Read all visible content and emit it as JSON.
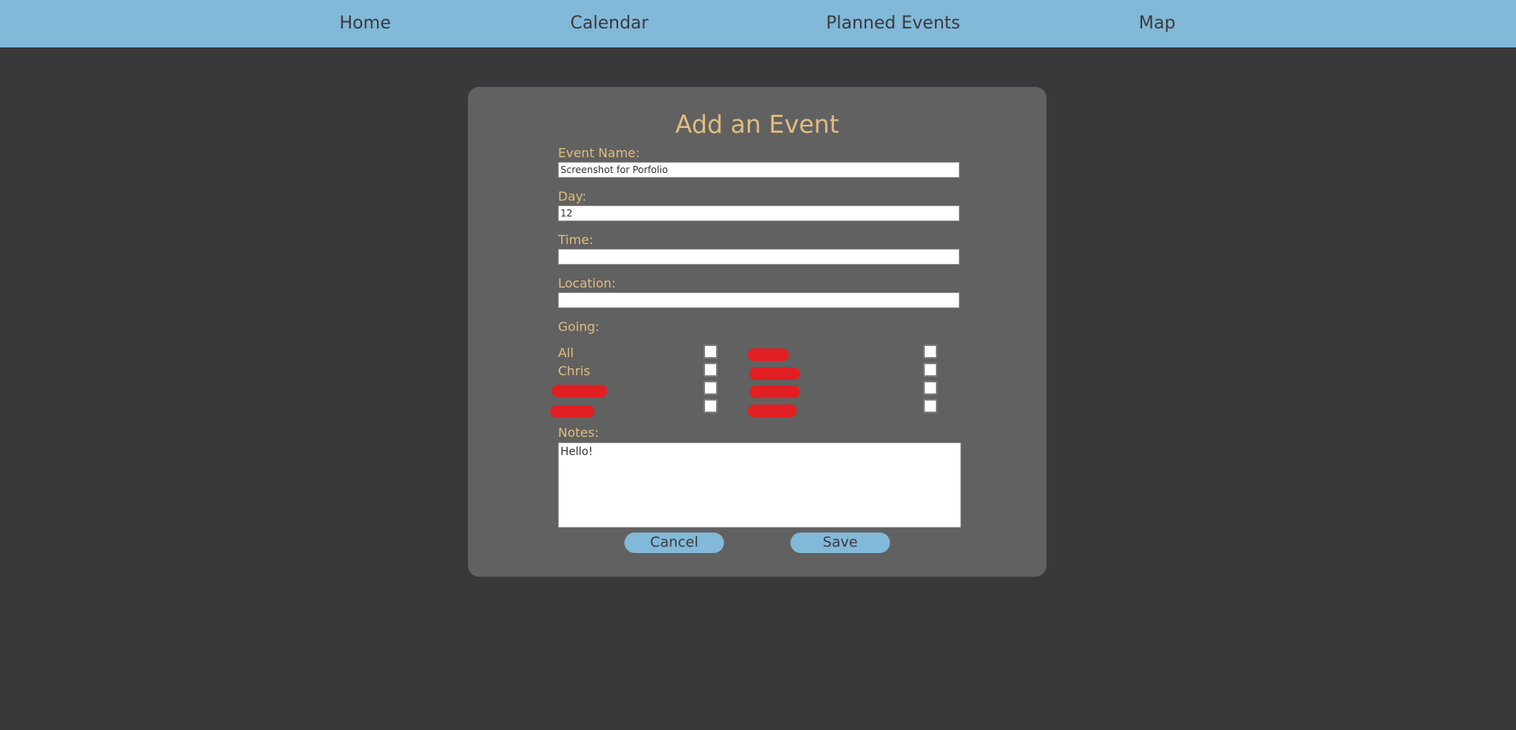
{
  "nav": {
    "items": [
      {
        "label": "Home"
      },
      {
        "label": "Calendar"
      },
      {
        "label": "Planned Events"
      },
      {
        "label": "Map"
      }
    ]
  },
  "form": {
    "title": "Add an Event",
    "event_name": {
      "label": "Event Name:",
      "value": "Screenshot for Porfolio"
    },
    "day": {
      "label": "Day:",
      "value": "12"
    },
    "time": {
      "label": "Time:",
      "value": ""
    },
    "location": {
      "label": "Location:",
      "value": ""
    },
    "going": {
      "label": "Going:",
      "people": [
        {
          "name": "All",
          "checked": false
        },
        {
          "name": "Chris",
          "checked": false
        }
      ]
    },
    "notes": {
      "label": "Notes:",
      "value": "Hello!"
    },
    "cancel_label": "Cancel",
    "save_label": "Save"
  },
  "colors": {
    "nav_bg": "#82b8d8",
    "page_bg": "#39393b",
    "card_bg": "#616161",
    "label_gold": "#e0bd7e",
    "redaction": "#e11f22"
  }
}
